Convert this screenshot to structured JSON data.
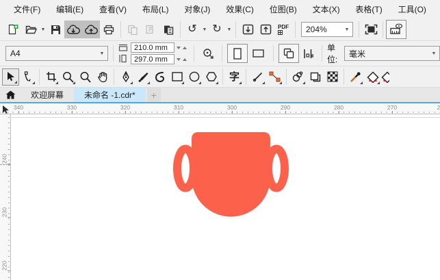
{
  "menu": {
    "items": [
      "文件(F)",
      "编辑(E)",
      "查看(V)",
      "布局(L)",
      "对象(J)",
      "效果(C)",
      "位图(B)",
      "文本(X)",
      "表格(T)",
      "工具(O)"
    ]
  },
  "standard_toolbar": {
    "zoom_level": "204%",
    "pdf_label": "PDF",
    "buttons": [
      "new-document",
      "open",
      "save",
      "cloud-download",
      "cloud-upload",
      "print",
      "copy",
      "duplicate",
      "paste",
      "undo",
      "redo",
      "import",
      "export",
      "publish-pdf",
      "zoom-level-combo",
      "full-screen-preview",
      "show-rulers"
    ]
  },
  "property_bar": {
    "page_size": "A4",
    "page_width": "210.0 mm",
    "page_height": "297.0 mm",
    "units_label": "单位:",
    "units_value": "毫米",
    "buttons": [
      "page-width",
      "page-height",
      "autofit",
      "portrait",
      "landscape",
      "all-pages",
      "current-page",
      "units-combo"
    ]
  },
  "toolbox": {
    "text_tool_glyph": "字",
    "tools": [
      "pick",
      "shape",
      "crop",
      "zoom",
      "zoom-2",
      "pan",
      "pen",
      "artistic-media",
      "b-spline",
      "rectangle",
      "ellipse",
      "polygon",
      "text",
      "straight-line",
      "connector",
      "drop-shadow",
      "contour",
      "transparency",
      "color-eyedropper",
      "interactive-fill",
      "smart-fill"
    ]
  },
  "tabs": {
    "items": [
      {
        "label": "欢迎屏幕",
        "active": false
      },
      {
        "label": "未命名 -1.cdr*",
        "active": true
      }
    ],
    "new_tab": "+"
  },
  "rulers": {
    "horizontal": [
      "340",
      "330",
      "320",
      "310",
      "300",
      "290",
      "280",
      "270"
    ],
    "horizontal_partial": "2",
    "vertical": [
      "240",
      "230",
      "220"
    ]
  },
  "canvas": {
    "shape": "trophy-cup",
    "shape_color": "#FC624B"
  },
  "colors": {
    "toolbar_bg": "#F1F1F1",
    "accent_blue": "#4FA8E3",
    "active_tab_bg": "#CBE7FA",
    "shape_fill": "#FC624B"
  }
}
